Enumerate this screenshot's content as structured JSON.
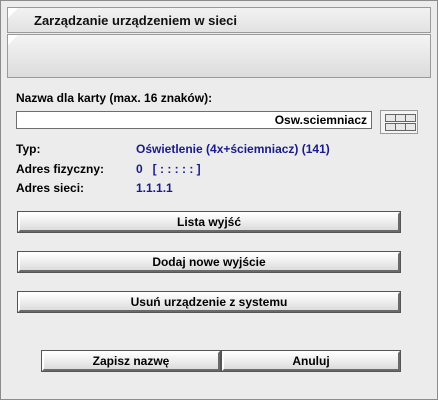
{
  "window": {
    "title": "Zarządzanie urządzeniem w sieci"
  },
  "form": {
    "name_label": "Nazwa dla karty (max. 16 znaków):",
    "name_value": "Osw.sciemniacz"
  },
  "info": {
    "type_label": "Typ:",
    "type_value": "Oświetlenie (4x+ściemniacz) (141)",
    "phys_label": "Adres fizyczny:",
    "phys_value": "0   [ : : : : : ]",
    "net_label": "Adres sieci:",
    "net_value": "1.1.1.1"
  },
  "actions": {
    "list_outputs": "Lista wyjść",
    "add_output": "Dodaj nowe wyjście",
    "remove_device": "Usuń urządzenie z systemu"
  },
  "footer": {
    "save": "Zapisz nazwę",
    "cancel": "Anuluj"
  },
  "icons": {
    "keyboard": "keyboard-icon"
  }
}
